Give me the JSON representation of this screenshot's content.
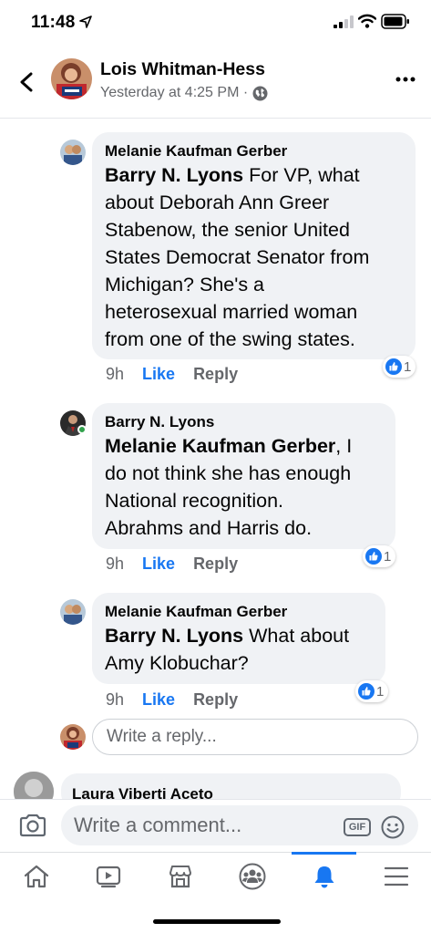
{
  "status_bar": {
    "time": "11:48"
  },
  "header": {
    "name": "Lois Whitman-Hess",
    "meta": "Yesterday at 4:25 PM ·"
  },
  "comments": [
    {
      "author": "Melanie Kaufman Gerber",
      "mention": "Barry N. Lyons",
      "text_lines": [
        "For VP, what",
        "about Deborah Ann Greer",
        "Stabenow, the senior United",
        "States Democrat Senator from",
        "Michigan? She's a",
        "heterosexual married woman",
        "from one of the swing states."
      ],
      "time": "9h",
      "like": "Like",
      "reply": "Reply",
      "reactions": "1"
    },
    {
      "author": "Barry N. Lyons",
      "mention": "Melanie Kaufman Gerber",
      "text_lines": [
        ", I",
        "do not think she has enough",
        "National recognition.",
        "Abrahms and Harris do."
      ],
      "time": "9h",
      "like": "Like",
      "reply": "Reply",
      "reactions": "1"
    },
    {
      "author": "Melanie Kaufman Gerber",
      "mention": "Barry N. Lyons",
      "text_lines": [
        "What about",
        "Amy Klobuchar?"
      ],
      "time": "9h",
      "like": "Like",
      "reply": "Reply",
      "reactions": "1"
    }
  ],
  "reply_box": {
    "placeholder": "Write a reply..."
  },
  "next_comment": {
    "author": "Laura Viberti Aceto"
  },
  "composer": {
    "placeholder": "Write a comment...",
    "gif": "GIF"
  },
  "colors": {
    "accent": "#1877f2",
    "bubble": "#f0f2f5",
    "muted": "#65676b",
    "online": "#31a24c"
  },
  "tabs": [
    {
      "icon": "home-icon"
    },
    {
      "icon": "watch-icon"
    },
    {
      "icon": "marketplace-icon"
    },
    {
      "icon": "groups-icon"
    },
    {
      "icon": "notifications-icon",
      "active": true
    },
    {
      "icon": "menu-icon"
    }
  ]
}
